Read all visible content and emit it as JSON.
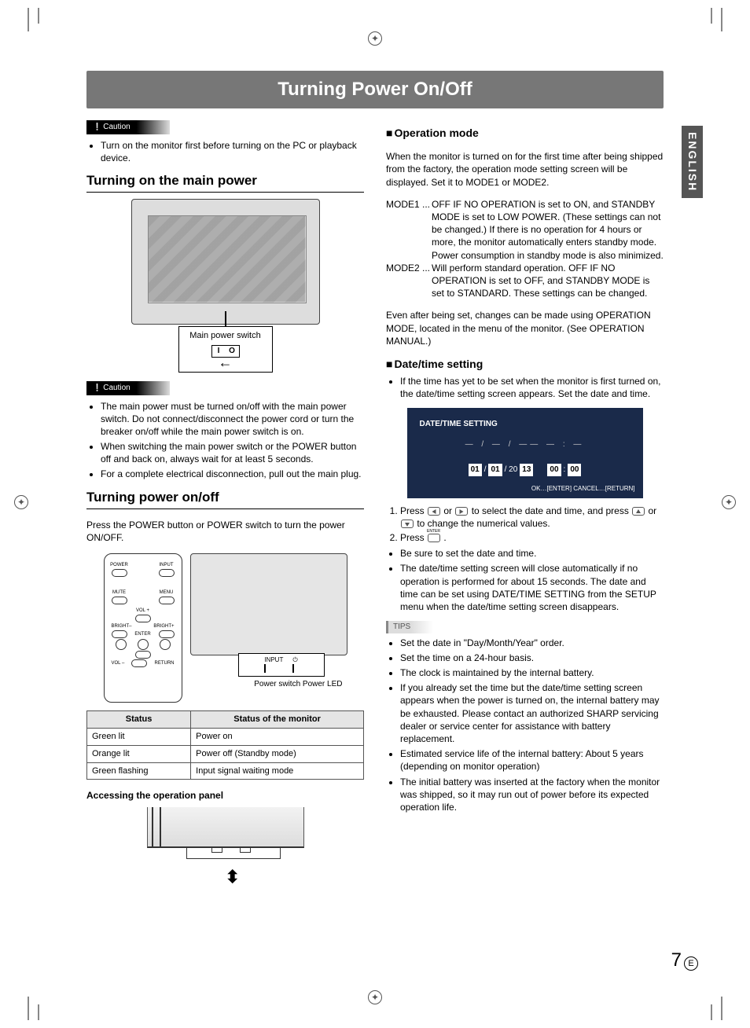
{
  "pageTitle": "Turning Power On/Off",
  "languageTab": "ENGLISH",
  "pageNumber": "7",
  "pageNumberSuffix": "E",
  "caution1": {
    "label": "Caution",
    "items": [
      "Turn on the monitor first before turning on the PC or playback device."
    ]
  },
  "sectionMainPower": {
    "heading": "Turning on the main power",
    "callout": "Main power switch",
    "ioOn": "I",
    "ioOff": "O"
  },
  "caution2": {
    "label": "Caution",
    "items": [
      "The main power must be turned on/off with the main power switch. Do not connect/disconnect the power cord or turn the breaker on/off while the main power switch is on.",
      "When switching the main power switch or the POWER button off and back on, always wait for at least 5 seconds.",
      "For a complete electrical disconnection, pull out the main plug."
    ]
  },
  "sectionPowerOnOff": {
    "heading": "Turning power on/off",
    "intro": "Press the POWER button or POWER switch to turn the power ON/OFF.",
    "remote": {
      "power": "POWER",
      "input": "INPUT",
      "mute": "MUTE",
      "menu": "MENU",
      "volPlus": "VOL +",
      "volMinus": "VOL –",
      "brightMinus": "BRIGHT–",
      "brightPlus": "BRIGHT+",
      "enter": "ENTER",
      "return": "RETURN"
    },
    "panelLabels": {
      "input": "INPUT",
      "power": "⏻"
    },
    "underLabels": "Power switch   Power LED"
  },
  "statusTable": {
    "headers": [
      "Status",
      "Status of the monitor"
    ],
    "rows": [
      [
        "Green lit",
        "Power on"
      ],
      [
        "Orange lit",
        "Power off (Standby mode)"
      ],
      [
        "Green flashing",
        "Input signal waiting mode"
      ]
    ]
  },
  "opPanelHeading": "Accessing the operation panel",
  "operationMode": {
    "heading": "Operation mode",
    "intro": "When the monitor is turned on for the first time after being shipped from the factory, the operation mode setting screen will be displayed. Set it to MODE1 or MODE2.",
    "mode1Label": "MODE1 ...",
    "mode1Text": "OFF IF NO OPERATION is set to ON, and STANDBY MODE is set to LOW POWER. (These settings can not be changed.) If there is no operation for 4 hours or more, the monitor automatically enters standby mode. Power consumption in standby mode is also minimized.",
    "mode2Label": "MODE2 ...",
    "mode2Text": "Will perform standard operation. OFF IF NO OPERATION is set to OFF, and STANDBY MODE is set to STANDARD. These settings can be changed.",
    "outro": "Even after being set, changes can be made using OPERATION MODE, located in the menu of the monitor. (See OPERATION MANUAL.)"
  },
  "dateTime": {
    "heading": "Date/time setting",
    "intro": "If the time has yet to be set when the monitor is first turned on, the date/time setting screen appears. Set the date and time.",
    "panel": {
      "title": "DATE/TIME SETTING",
      "dashes": "— / — / ——     — : —",
      "d1": "01",
      "sep1": "/",
      "d2": "01",
      "sep2": "/ 20",
      "d3": "13",
      "t1": "00",
      "sepT": ":",
      "t2": "00",
      "footer": "OK…[ENTER]   CANCEL…[RETURN]"
    },
    "steps": [
      "Press __LR__ to select the date and time, and press __UD__ to change the numerical values.",
      "Press __ENTER__."
    ],
    "afterSteps": [
      "Be sure to set the date and time.",
      "The date/time setting screen will close automatically if no operation is performed for about 15 seconds. The date and time can be set using DATE/TIME SETTING from the SETUP menu when the date/time setting screen disappears."
    ]
  },
  "tips": {
    "label": "TIPS",
    "items": [
      "Set the date in \"Day/Month/Year\" order.",
      "Set the time on a 24-hour basis.",
      "The clock is maintained by the internal battery.",
      "If you already set the time but the date/time setting screen appears when the power is turned on, the internal battery may be exhausted. Please contact an authorized SHARP servicing dealer or service center for assistance with battery replacement.",
      "Estimated service life of the internal battery: About 5 years (depending on monitor operation)",
      "The initial battery was inserted at the factory when the monitor was shipped, so it may run out of power before its expected operation life."
    ]
  }
}
